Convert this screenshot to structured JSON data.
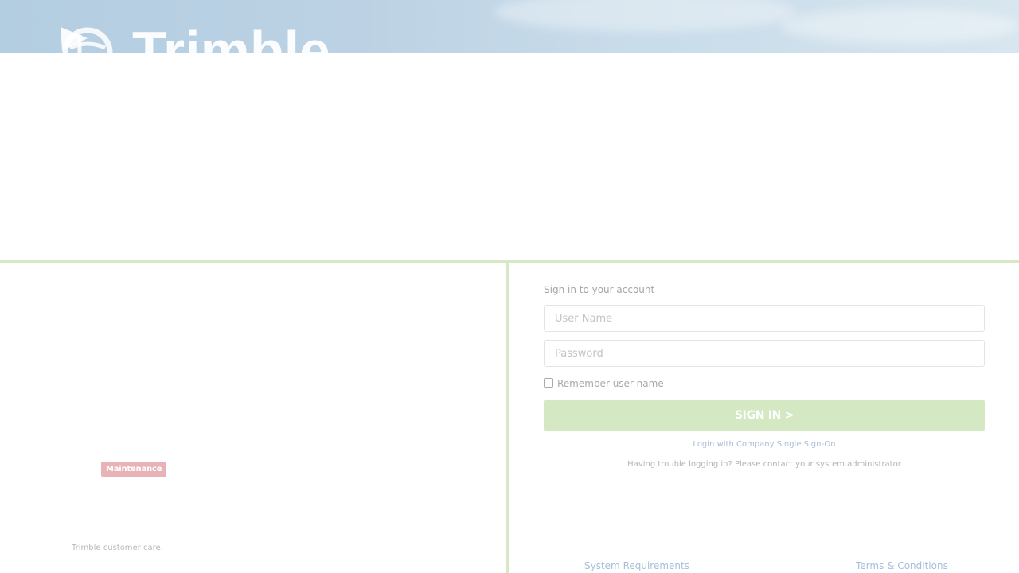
{
  "brand": {
    "logo_text": "Trimble"
  },
  "left_panel": {
    "maintenance_badge": "Maintenance",
    "customer_care_text": "Trimble customer care."
  },
  "login_form": {
    "heading": "Sign in to your account",
    "username_placeholder": "User Name",
    "password_placeholder": "Password",
    "remember_label": "Remember user name",
    "remember_checked": false,
    "sign_in_label": "SIGN IN >",
    "sso_link": "Login with Company Single Sign-On",
    "trouble_text": "Having trouble logging in? Please contact your system administrator"
  },
  "footer": {
    "system_requirements": "System Requirements",
    "terms": "Terms & Conditions"
  },
  "colors": {
    "accent_green": "#d4e8c3",
    "divider_green": "#d6e8c5",
    "link_blue": "#a7bed8",
    "maintenance_red": "#e7b3b7",
    "hero_sky": "#bcd2e4"
  },
  "icons": [
    "trimble-globe-logo-icon",
    "checkbox-icon"
  ]
}
